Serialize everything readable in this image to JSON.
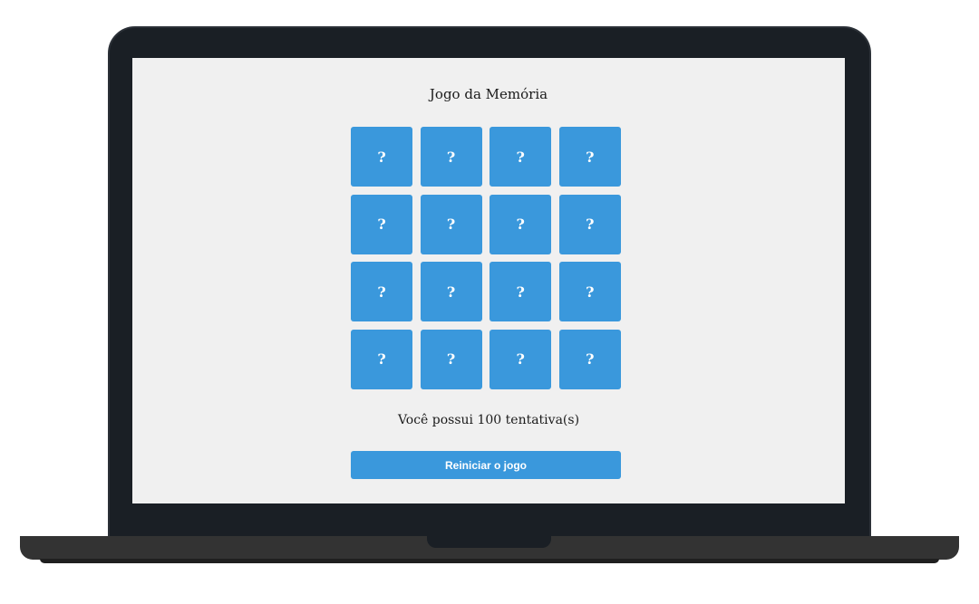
{
  "game": {
    "title": "Jogo da Memória",
    "cards": [
      {
        "face": "?"
      },
      {
        "face": "?"
      },
      {
        "face": "?"
      },
      {
        "face": "?"
      },
      {
        "face": "?"
      },
      {
        "face": "?"
      },
      {
        "face": "?"
      },
      {
        "face": "?"
      },
      {
        "face": "?"
      },
      {
        "face": "?"
      },
      {
        "face": "?"
      },
      {
        "face": "?"
      },
      {
        "face": "?"
      },
      {
        "face": "?"
      },
      {
        "face": "?"
      },
      {
        "face": "?"
      }
    ],
    "attempts_text": "Você possui 100 tentativa(s)",
    "restart_label": "Reiniciar o jogo"
  },
  "colors": {
    "card": "#3a98dc",
    "screen_bg": "#f0f0f0",
    "bezel": "#1a1f25"
  }
}
